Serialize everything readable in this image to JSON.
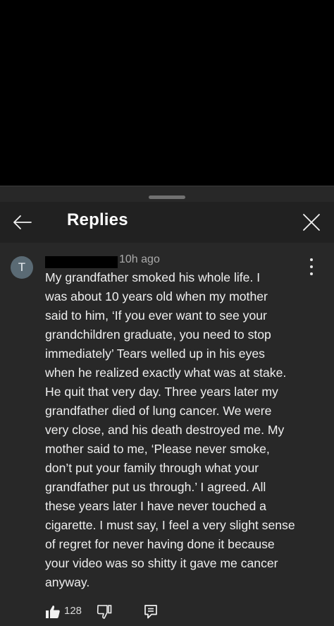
{
  "panel": {
    "title": "Replies"
  },
  "comment": {
    "avatar_letter": "T",
    "author": "",
    "timestamp": "10h ago",
    "text": "My grandfather smoked his whole life. I\nwas about 10 years old when my mother\nsaid to him, ‘If you ever want to see your\ngrandchildren graduate, you need to stop\nimmediately’ Tears welled up in his eyes\nwhen he realized exactly what was at stake.\nHe quit that very day. Three years later my\ngrandfather died of lung cancer. We were\nvery close, and his death destroyed me. My\nmother said to me, ‘Please never smoke,\ndon’t put your family through what your\ngrandfather put us through.’ I agreed. All\nthese years later I have never touched a\ncigarette. I must say, I feel a very slight sense\nof regret for never having done it because\nyour video was so shitty it gave me cancer\nanyway.",
    "like_count": "128",
    "avatar_color": "#5a6a74"
  },
  "icons": {
    "back": "back-arrow-icon",
    "close": "close-icon",
    "menu": "more-vertical-icon",
    "like": "thumbs-up-icon",
    "dislike": "thumbs-down-icon",
    "reply": "reply-icon"
  },
  "colors": {
    "background": "#000000",
    "panel": "#282828",
    "header": "#212121",
    "text": "#efefef",
    "muted": "#aaaaaa"
  }
}
